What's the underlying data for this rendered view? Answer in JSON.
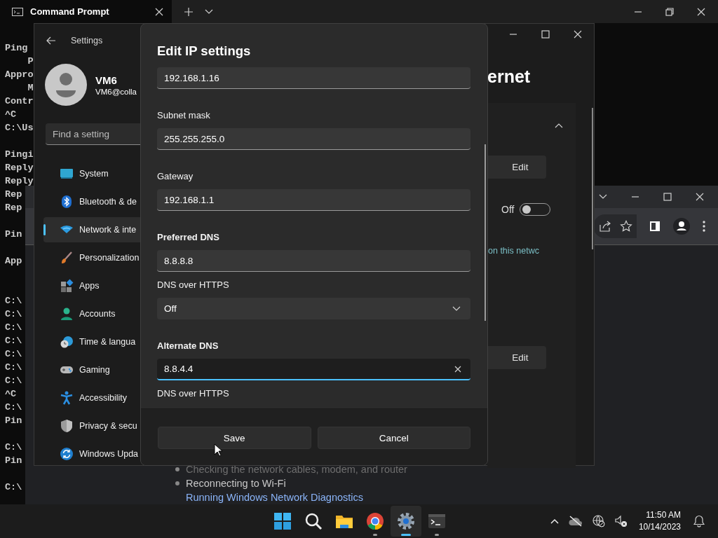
{
  "terminal": {
    "tab_title": "Command Prompt",
    "lines": [
      {
        "kind": "text",
        "text": "Ping"
      },
      {
        "kind": "text",
        "text": "    P"
      },
      {
        "kind": "text",
        "text": "Appro"
      },
      {
        "kind": "text",
        "text": "    M"
      },
      {
        "kind": "text",
        "text": "Contr"
      },
      {
        "kind": "text",
        "text": "^C"
      },
      {
        "kind": "text",
        "text": "C:\\Us"
      },
      {
        "kind": "blank"
      },
      {
        "kind": "text",
        "text": "Pingi"
      },
      {
        "kind": "text",
        "text": "Reply"
      },
      {
        "kind": "text",
        "text": "Reply"
      },
      {
        "kind": "text",
        "text": "Rep"
      },
      {
        "kind": "text",
        "text": "Rep"
      },
      {
        "kind": "blank"
      },
      {
        "kind": "text",
        "text": "Pin"
      },
      {
        "kind": "blank"
      },
      {
        "kind": "text",
        "text": "App"
      },
      {
        "kind": "blank"
      },
      {
        "kind": "blank"
      },
      {
        "kind": "text",
        "text": "C:\\"
      },
      {
        "kind": "text",
        "text": "C:\\"
      },
      {
        "kind": "text",
        "text": "C:\\"
      },
      {
        "kind": "text",
        "text": "C:\\"
      },
      {
        "kind": "text",
        "text": "C:\\"
      },
      {
        "kind": "text",
        "text": "C:\\"
      },
      {
        "kind": "text",
        "text": "C:\\"
      },
      {
        "kind": "text",
        "text": "^C"
      },
      {
        "kind": "text",
        "text": "C:\\"
      },
      {
        "kind": "text",
        "text": "Pin"
      },
      {
        "kind": "blank"
      },
      {
        "kind": "text",
        "text": "C:\\"
      },
      {
        "kind": "text",
        "text": "Pin"
      },
      {
        "kind": "blank"
      },
      {
        "kind": "text",
        "text": "C:\\"
      }
    ]
  },
  "settings": {
    "app_title": "Settings",
    "user": {
      "name": "VM6",
      "email": "VM6@colla"
    },
    "search": {
      "placeholder": "Find a setting"
    },
    "nav": [
      {
        "kind": "system",
        "label": "System",
        "selected": false
      },
      {
        "kind": "bluetooth",
        "label": "Bluetooth & de",
        "selected": false
      },
      {
        "kind": "network",
        "label": "Network & inte",
        "selected": true
      },
      {
        "kind": "personalization",
        "label": "Personalization",
        "selected": false
      },
      {
        "kind": "apps",
        "label": "Apps",
        "selected": false
      },
      {
        "kind": "accounts",
        "label": "Accounts",
        "selected": false
      },
      {
        "kind": "time",
        "label": "Time & langua",
        "selected": false
      },
      {
        "kind": "gaming",
        "label": "Gaming",
        "selected": false
      },
      {
        "kind": "accessibility",
        "label": "Accessibility",
        "selected": false
      },
      {
        "kind": "privacy",
        "label": "Privacy & secu",
        "selected": false
      },
      {
        "kind": "update",
        "label": "Windows Upda",
        "selected": false
      }
    ],
    "page_title": "ernet",
    "first_edit": "Edit",
    "toggle": {
      "label": "Off",
      "on": false
    },
    "link": "on this netwc",
    "second_edit": "Edit"
  },
  "dialog": {
    "title": "Edit IP settings",
    "items": [
      {
        "kind": "field",
        "value": "192.168.1.16",
        "focused": false
      },
      {
        "kind": "field",
        "label": "Subnet mask",
        "emphasis": false,
        "value": "255.255.255.0",
        "focused": false
      },
      {
        "kind": "field",
        "label": "Gateway",
        "emphasis": false,
        "value": "192.168.1.1",
        "focused": false
      },
      {
        "kind": "field",
        "label": "Preferred DNS",
        "emphasis": true,
        "value": "8.8.8.8",
        "focused": false
      },
      {
        "kind": "dropdown",
        "label": "DNS over HTTPS",
        "emphasis": false,
        "value": "Off"
      },
      {
        "kind": "field",
        "label": "Alternate DNS",
        "emphasis": true,
        "value": "8.8.4.4",
        "focused": true
      },
      {
        "kind": "label",
        "label": "DNS over HTTPS",
        "emphasis": false
      }
    ],
    "buttons": [
      "Save",
      "Cancel"
    ]
  },
  "browser": {
    "page_lines": [
      {
        "kind": "bullet",
        "text": "Checking the network cables, modem, and router",
        "dimmed": true
      },
      {
        "kind": "bullet",
        "text": "Reconnecting to Wi-Fi",
        "dimmed": false
      },
      {
        "kind": "link",
        "text": "Running Windows Network Diagnostics",
        "dimmed": false
      }
    ]
  },
  "taskbar": {
    "apps": [
      {
        "kind": "start",
        "active": false,
        "running": false
      },
      {
        "kind": "search",
        "active": false,
        "running": false
      },
      {
        "kind": "files",
        "active": false,
        "running": false
      },
      {
        "kind": "browser",
        "active": false,
        "running": true
      },
      {
        "kind": "settings",
        "active": true,
        "running": true
      },
      {
        "kind": "terminal",
        "active": false,
        "running": true
      }
    ],
    "time": "11:50 AM",
    "date": "10/14/2023"
  }
}
